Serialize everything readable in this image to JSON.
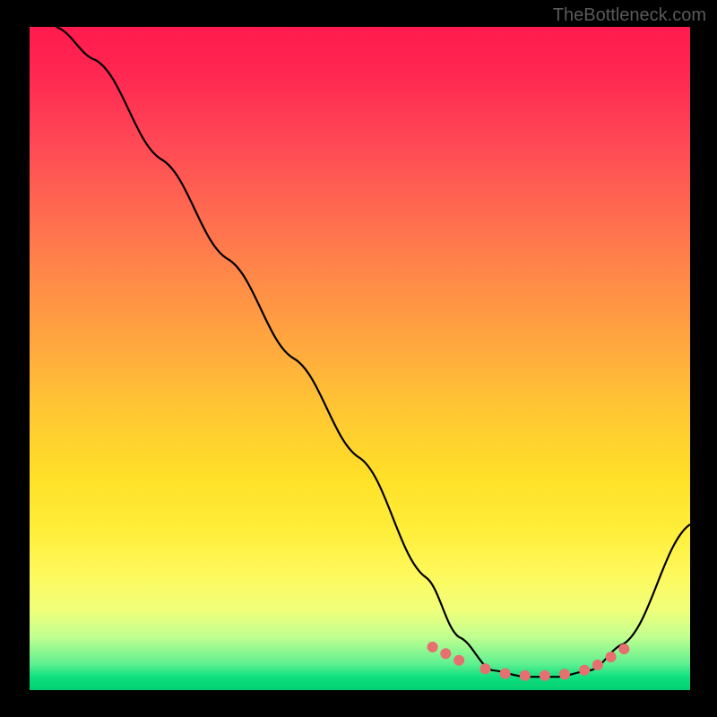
{
  "attribution": "TheBottleneck.com",
  "chart_data": {
    "type": "line",
    "title": "",
    "xlabel": "",
    "ylabel": "",
    "xlim": [
      0,
      100
    ],
    "ylim": [
      0,
      100
    ],
    "series": [
      {
        "name": "curve",
        "x": [
          4,
          10,
          20,
          30,
          40,
          50,
          60,
          65,
          70,
          75,
          80,
          85,
          90,
          100
        ],
        "y": [
          100,
          95,
          80,
          65,
          50,
          35,
          17,
          8,
          3,
          2,
          2,
          3,
          7,
          25
        ]
      }
    ],
    "markers": {
      "name": "highlight",
      "x": [
        61,
        63,
        65,
        69,
        72,
        75,
        78,
        81,
        84,
        86,
        88,
        90
      ],
      "y": [
        6.5,
        5.5,
        4.5,
        3.2,
        2.5,
        2.2,
        2.2,
        2.4,
        3.0,
        3.8,
        5.0,
        6.2
      ]
    },
    "background": "vertical-gradient red-yellow-green"
  }
}
